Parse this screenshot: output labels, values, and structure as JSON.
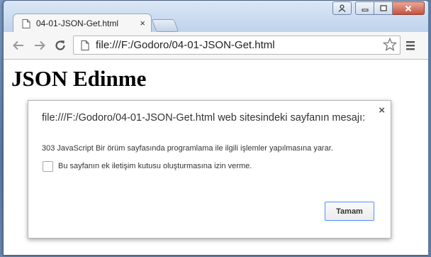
{
  "browser": {
    "tab": {
      "title": "04-01-JSON-Get.html",
      "close_label": "×",
      "icon": "page-icon"
    },
    "toolbar": {
      "back_icon": "back-arrow-icon",
      "forward_icon": "forward-arrow-icon",
      "reload_icon": "reload-icon",
      "url": "file:///F:/Godoro/04-01-JSON-Get.html",
      "bookmark_icon": "star-icon",
      "menu_icon": "hamburger-menu-icon"
    },
    "window_controls": [
      "user-icon",
      "minimize-icon",
      "maximize-icon",
      "close-icon"
    ]
  },
  "page": {
    "heading": "JSON Edinme"
  },
  "dialog": {
    "title": "file:///F:/Godoro/04-01-JSON-Get.html web sitesindeki sayfanın mesajı:",
    "close_label": "×",
    "message": "303 JavaScript Bir örüm sayfasında programlama ile ilgili işlemler yapılmasına yarar.",
    "checkbox_label": "Bu sayfanın ek iletişim kutusu oluşturmasına izin verme.",
    "checkbox_checked": false,
    "ok_label": "Tamam"
  },
  "colors": {
    "accent_focus": "#4d90fe",
    "window_frame": "#c9d9ef",
    "close_red": "#c8533d"
  }
}
